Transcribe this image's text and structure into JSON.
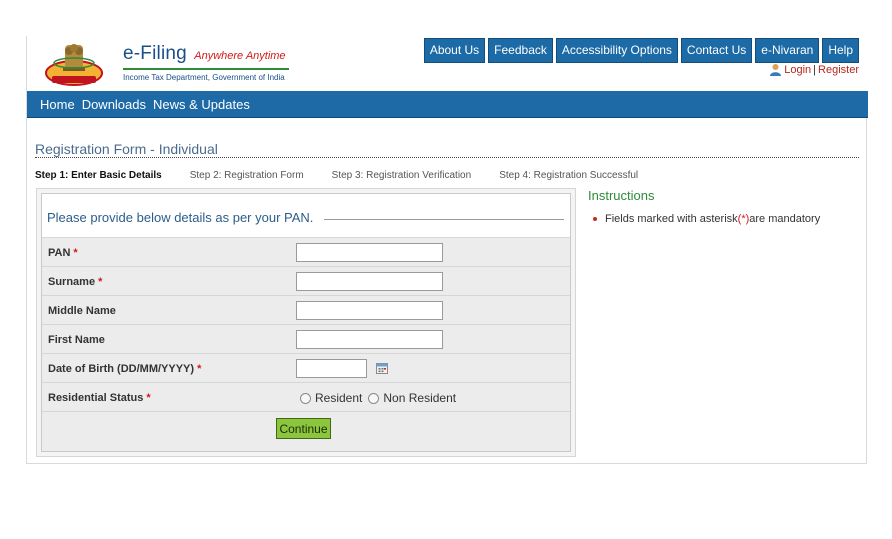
{
  "brand": {
    "title": "e-Filing",
    "tagline": "Anywhere Anytime",
    "subtitle": "Income Tax Department, Government of India"
  },
  "top_nav": [
    "About Us",
    "Feedback",
    "Accessibility Options",
    "Contact Us",
    "e-Nivaran",
    "Help"
  ],
  "account": {
    "login": "Login",
    "separator": "|",
    "register": "Register"
  },
  "main_nav": [
    "Home",
    "Downloads",
    "News & Updates"
  ],
  "page_title": "Registration Form - Individual",
  "steps": [
    "Step 1: Enter Basic Details",
    "Step 2: Registration Form",
    "Step 3: Registration Verification",
    "Step 4: Registration Successful"
  ],
  "form": {
    "heading": "Please provide below details as per your PAN.",
    "fields": [
      {
        "label": "PAN",
        "required": "*",
        "value": ""
      },
      {
        "label": "Surname",
        "required": "*",
        "value": ""
      },
      {
        "label": "Middle Name",
        "required": "",
        "value": ""
      },
      {
        "label": "First Name",
        "required": "",
        "value": ""
      },
      {
        "label": "Date of Birth (DD/MM/YYYY)",
        "required": "*",
        "value": ""
      },
      {
        "label": "Residential Status",
        "required": "*"
      }
    ],
    "residential_options": [
      "Resident",
      "Non Resident"
    ],
    "continue_label": "Continue"
  },
  "instructions": {
    "title": "Instructions",
    "item_prefix": "Fields marked with asterisk",
    "item_mark": "(*)",
    "item_suffix": " are mandatory"
  },
  "colors": {
    "nav_blue": "#1d6aa6",
    "brand_green": "#2e8b3a",
    "required_red": "#d11a1a",
    "button_green": "#8cc63f"
  }
}
